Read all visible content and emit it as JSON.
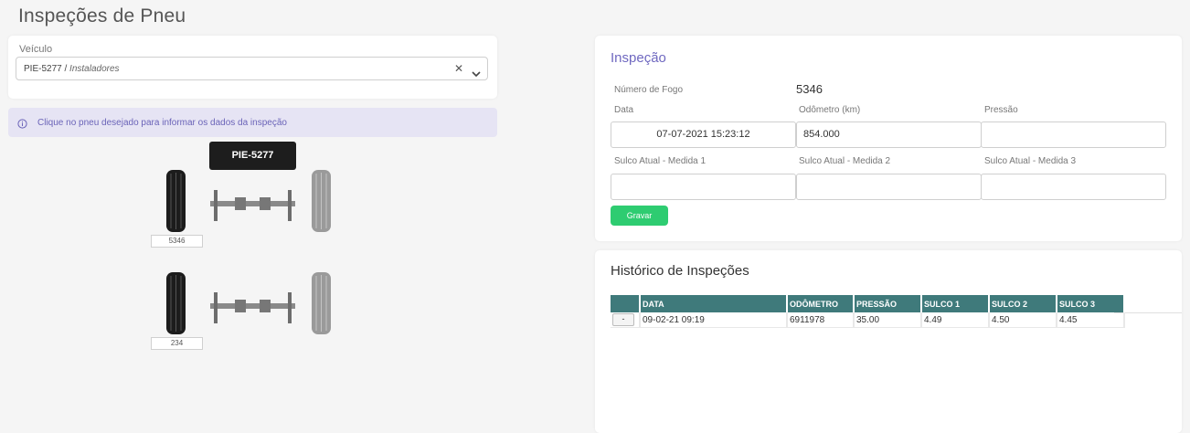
{
  "page": {
    "title": "Inspeções de Pneu"
  },
  "vehicle": {
    "label": "Veículo",
    "plate": "PIE-5277",
    "separator": " / ",
    "group": "Instaladores"
  },
  "info": {
    "message": "Clique no pneu desejado para informar os dados da inspeção"
  },
  "diagram": {
    "plate": "PIE-5277",
    "axles": [
      {
        "left_tire_number": "5346"
      },
      {
        "left_tire_number": "234"
      }
    ]
  },
  "inspection": {
    "title": "Inspeção",
    "fogo_label": "Número de Fogo",
    "fogo_value": "5346",
    "data_label": "Data",
    "data_value": "07-07-2021 15:23:12",
    "odometro_label": "Odômetro (km)",
    "odometro_value": "854.000",
    "pressao_label": "Pressão",
    "pressao_value": "",
    "sulco1_label": "Sulco Atual - Medida 1",
    "sulco2_label": "Sulco Atual - Medida 2",
    "sulco3_label": "Sulco Atual - Medida 3",
    "save_label": "Gravar"
  },
  "history": {
    "title": "Histórico de Inspeções",
    "headers": [
      "",
      "DATA",
      "ODÔMETRO",
      "PRESSÃO",
      "SULCO 1",
      "SULCO 2",
      "SULCO 3"
    ],
    "rows": [
      {
        "action": "-",
        "data": "09-02-21 09:19",
        "odometro": "6911978",
        "pressao": "35.00",
        "sulco1": "4.49",
        "sulco2": "4.50",
        "sulco3": "4.45"
      }
    ]
  },
  "colors": {
    "accent": "#6f68c0",
    "table_header": "#3f7a7b",
    "save": "#2ecc71",
    "info_bg": "#e6e4f4"
  }
}
